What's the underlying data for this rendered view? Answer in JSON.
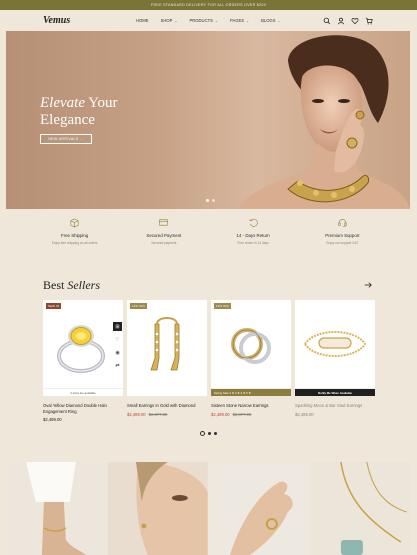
{
  "announcement": "FREE STANDARD DELIVERY FOR ALL ORDERS OVER $200",
  "header": {
    "logo": "Vemus",
    "nav": [
      {
        "label": "HOME"
      },
      {
        "label": "SHOP"
      },
      {
        "label": "PRODUCTS"
      },
      {
        "label": "PAGES"
      },
      {
        "label": "BLOGS"
      }
    ],
    "icons": [
      "search-icon",
      "user-icon",
      "heart-icon",
      "cart-icon"
    ]
  },
  "hero": {
    "title_italic": "Elevate",
    "title_rest": " Your",
    "title_line2": "Elegance",
    "button": "NEW ARRIVALS →",
    "slides": 2,
    "active_slide": 1
  },
  "features": [
    {
      "icon": "box-icon",
      "title": "Free Shipping",
      "subtitle": "Enjoy free shipping on all orders"
    },
    {
      "icon": "card-icon",
      "title": "Secured Payment",
      "subtitle": "Secured payment"
    },
    {
      "icon": "return-icon",
      "title": "14 - Days Return",
      "subtitle": "Free return in 14 days"
    },
    {
      "icon": "headset-icon",
      "title": "Premium Support",
      "subtitle": "Enjoy our support 24/7"
    }
  ],
  "best_sellers": {
    "title_plain": "Best ",
    "title_italic": "Sellers",
    "products": [
      {
        "badge": "NEW IN",
        "badge_color": "#8b4a2b",
        "name": "Oval Yellow Diamond Double Halo Engagement Ring",
        "price": "$2,499.00",
        "price_old": "",
        "on_sale": false,
        "strip": "2 sizes are available",
        "strip_style": "light"
      },
      {
        "badge": "10% OFF",
        "badge_color": "#9b8a4a",
        "name": "Small Earrings In Gold with Diamond",
        "price": "$2,499.00",
        "price_old": "$2,877.00",
        "on_sale": true,
        "strip": "",
        "strip_style": "none"
      },
      {
        "badge": "10% OFF",
        "badge_color": "#9b8a4a",
        "name": "Sixteen Stone Narrow Earrings",
        "price": "$2,499.00",
        "price_old": "$2,877.00",
        "on_sale": true,
        "strip": "Spring Sale  4 ★ 2 ★ 4 ★ 5 ★",
        "strip_style": "gold"
      },
      {
        "badge": "",
        "badge_color": "",
        "name": "Sparkling Moon & Bar Stud Earrings",
        "price": "$2,499.00",
        "price_old": "",
        "on_sale": false,
        "strip": "Notify Me When Available",
        "strip_style": "dark"
      }
    ],
    "pagination": {
      "pages": 3,
      "active": 1
    }
  },
  "colors": {
    "background": "#efe8da",
    "topbar": "#7a7436",
    "sale": "#c0433a",
    "hero": "#c7a186"
  }
}
